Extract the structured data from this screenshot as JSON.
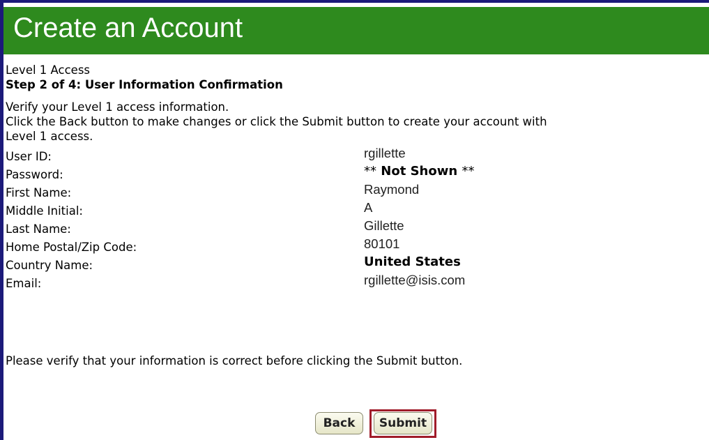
{
  "header": {
    "title": "Create an Account"
  },
  "intro": {
    "access_level": "Level 1 Access",
    "step": "Step 2 of 4: User Information Confirmation",
    "instruction_1": "Verify your Level 1 access information.",
    "instruction_2": "Click the Back button to make changes or click the Submit button to create your account with",
    "instruction_3": "Level 1 access."
  },
  "fields": {
    "user_id": {
      "label": "User ID:",
      "value": "rgillette"
    },
    "password": {
      "label": "Password:",
      "stars_before": "**",
      "value": "Not Shown",
      "stars_after": "**"
    },
    "first_name": {
      "label": "First Name:",
      "value": "Raymond"
    },
    "middle_initial": {
      "label": "Middle Initial:",
      "value": "A"
    },
    "last_name": {
      "label": "Last Name:",
      "value": "Gillette"
    },
    "postal_code": {
      "label": "Home Postal/Zip Code:",
      "value": "80101"
    },
    "country": {
      "label": "Country Name:",
      "value": "United States"
    },
    "email": {
      "label": "Email:",
      "value": "rgillette@isis.com"
    }
  },
  "footer": {
    "verify_text": "Please verify that your information is correct before clicking the Submit button."
  },
  "buttons": {
    "back_label": "Back",
    "submit_label": "Submit"
  },
  "colors": {
    "header_bg": "#2e8a1e",
    "frame_border": "#1c1a7a",
    "submit_focus_outline": "#a01c2a"
  }
}
